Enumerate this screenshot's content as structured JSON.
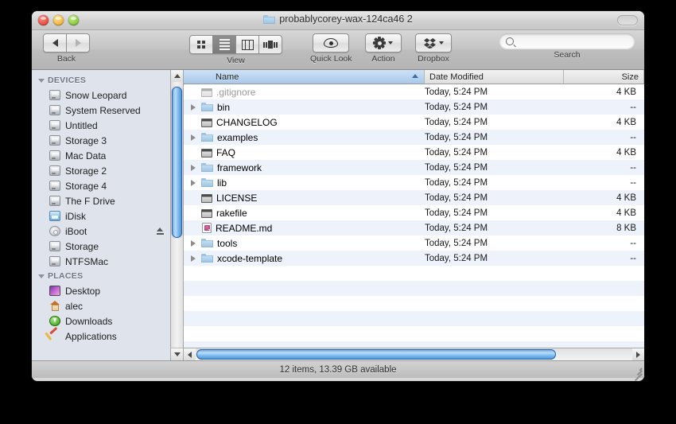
{
  "window": {
    "title": "probablycorey-wax-124ca46 2",
    "traffic_lights": [
      "close-button",
      "minimize-button",
      "zoom-button"
    ]
  },
  "toolbar": {
    "back_label": "Back",
    "back_icon": "arrow-left-icon",
    "forward_icon": "arrow-right-icon",
    "view_label": "View",
    "view_modes": [
      {
        "name": "icon-view",
        "icon": "grid-icon",
        "selected": false
      },
      {
        "name": "list-view",
        "icon": "list-icon",
        "selected": true
      },
      {
        "name": "column-view",
        "icon": "columns-icon",
        "selected": false
      },
      {
        "name": "coverflow-view",
        "icon": "coverflow-icon",
        "selected": false
      }
    ],
    "quick_look_label": "Quick Look",
    "quick_look_icon": "eye-icon",
    "action_label": "Action",
    "action_icon": "gear-icon",
    "dropbox_label": "Dropbox",
    "dropbox_icon": "dropbox-icon",
    "search_label": "Search",
    "search_placeholder": "",
    "search_value": "",
    "search_icon": "magnifier-icon"
  },
  "sidebar": {
    "sections": [
      {
        "title": "DEVICES",
        "items": [
          {
            "label": "Snow Leopard",
            "icon": "hard-drive-icon",
            "eject": false
          },
          {
            "label": "System Reserved",
            "icon": "hard-drive-icon",
            "eject": false
          },
          {
            "label": "Untitled",
            "icon": "hard-drive-icon",
            "eject": false
          },
          {
            "label": "Storage 3",
            "icon": "hard-drive-icon",
            "eject": false
          },
          {
            "label": "Mac Data",
            "icon": "hard-drive-icon",
            "eject": false
          },
          {
            "label": "Storage 2",
            "icon": "hard-drive-icon",
            "eject": false
          },
          {
            "label": "Storage 4",
            "icon": "hard-drive-icon",
            "eject": false
          },
          {
            "label": "The F Drive",
            "icon": "hard-drive-icon",
            "eject": false
          },
          {
            "label": "iDisk",
            "icon": "idisk-icon",
            "eject": false
          },
          {
            "label": "iBoot",
            "icon": "disc-icon",
            "eject": true
          },
          {
            "label": "Storage",
            "icon": "hard-drive-icon",
            "eject": false
          },
          {
            "label": "NTFSMac",
            "icon": "hard-drive-icon",
            "eject": false
          }
        ]
      },
      {
        "title": "PLACES",
        "items": [
          {
            "label": "Desktop",
            "icon": "desktop-icon",
            "eject": false
          },
          {
            "label": "alec",
            "icon": "home-icon",
            "eject": false
          },
          {
            "label": "Downloads",
            "icon": "downloads-icon",
            "eject": false
          },
          {
            "label": "Applications",
            "icon": "applications-icon",
            "eject": false
          }
        ]
      }
    ]
  },
  "filelist": {
    "columns": [
      {
        "label": "Name",
        "sorted": true,
        "sort_direction": "ascending"
      },
      {
        "label": "Date Modified",
        "sorted": false
      },
      {
        "label": "Size",
        "sorted": false
      }
    ],
    "rows": [
      {
        "name": ".gitignore",
        "icon": "document-icon",
        "expandable": false,
        "dimmed": true,
        "date": "Today, 5:24 PM",
        "size": "4 KB"
      },
      {
        "name": "bin",
        "icon": "folder-icon",
        "expandable": true,
        "dimmed": false,
        "date": "Today, 5:24 PM",
        "size": "--"
      },
      {
        "name": "CHANGELOG",
        "icon": "document-icon",
        "expandable": false,
        "dimmed": false,
        "date": "Today, 5:24 PM",
        "size": "4 KB"
      },
      {
        "name": "examples",
        "icon": "folder-icon",
        "expandable": true,
        "dimmed": false,
        "date": "Today, 5:24 PM",
        "size": "--"
      },
      {
        "name": "FAQ",
        "icon": "document-icon",
        "expandable": false,
        "dimmed": false,
        "date": "Today, 5:24 PM",
        "size": "4 KB"
      },
      {
        "name": "framework",
        "icon": "folder-icon",
        "expandable": true,
        "dimmed": false,
        "date": "Today, 5:24 PM",
        "size": "--"
      },
      {
        "name": "lib",
        "icon": "folder-icon",
        "expandable": true,
        "dimmed": false,
        "date": "Today, 5:24 PM",
        "size": "--"
      },
      {
        "name": "LICENSE",
        "icon": "document-icon",
        "expandable": false,
        "dimmed": false,
        "date": "Today, 5:24 PM",
        "size": "4 KB"
      },
      {
        "name": "rakefile",
        "icon": "document-icon",
        "expandable": false,
        "dimmed": false,
        "date": "Today, 5:24 PM",
        "size": "4 KB"
      },
      {
        "name": "README.md",
        "icon": "markdown-file-icon",
        "expandable": false,
        "dimmed": false,
        "date": "Today, 5:24 PM",
        "size": "8 KB"
      },
      {
        "name": "tools",
        "icon": "folder-icon",
        "expandable": true,
        "dimmed": false,
        "date": "Today, 5:24 PM",
        "size": "--"
      },
      {
        "name": "xcode-template",
        "icon": "folder-icon",
        "expandable": true,
        "dimmed": false,
        "date": "Today, 5:24 PM",
        "size": "--"
      }
    ]
  },
  "statusbar": {
    "text": "12 items, 13.39 GB available"
  },
  "colors": {
    "selected_column": "#a8c8ea",
    "alt_row": "#edf2fb",
    "sidebar_bg": "#dfe4ec",
    "scrollbar_blue": "#4a8fd4"
  }
}
